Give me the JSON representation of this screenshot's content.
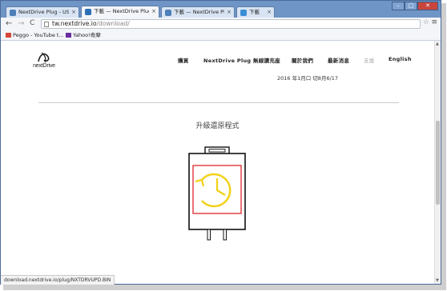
{
  "tabs": [
    {
      "label": "NextDrive Plug - USB Wi",
      "active": false
    },
    {
      "label": "下載 — NextDrive Plug",
      "active": true
    },
    {
      "label": "下載 — NextDrive Plug",
      "active": false
    },
    {
      "label": "下載",
      "active": false
    }
  ],
  "window_controls": {
    "minimize": "–",
    "maximize": "□",
    "close": "✕"
  },
  "toolbar": {
    "back": "←",
    "forward": "→",
    "reload": "C",
    "url_host": "tw.nextdrive.io",
    "url_path": "/download/",
    "star": "☆",
    "menu": "≡"
  },
  "bookmarks": [
    {
      "label": "Peggo - YouTube t...",
      "icon_color": "#d44638"
    },
    {
      "label": "Yahoo!奇摩",
      "icon_color": "#6b2ea0"
    }
  ],
  "site": {
    "logo_text": "nextDrive",
    "nav": [
      "購買",
      "NextDrive Plug 無線讀充座",
      "關於我們",
      "最新消息",
      "支援",
      "English"
    ],
    "nav_muted_index": 4,
    "sub_text": "2016 年1月口 切8月6/17",
    "section_title": "升級還原程式",
    "accent_yellow": "#f2d21a",
    "accent_red": "#e0262b"
  },
  "status_bar": "download.nextdrive.io/plug/NXTDRVUPD.BIN"
}
